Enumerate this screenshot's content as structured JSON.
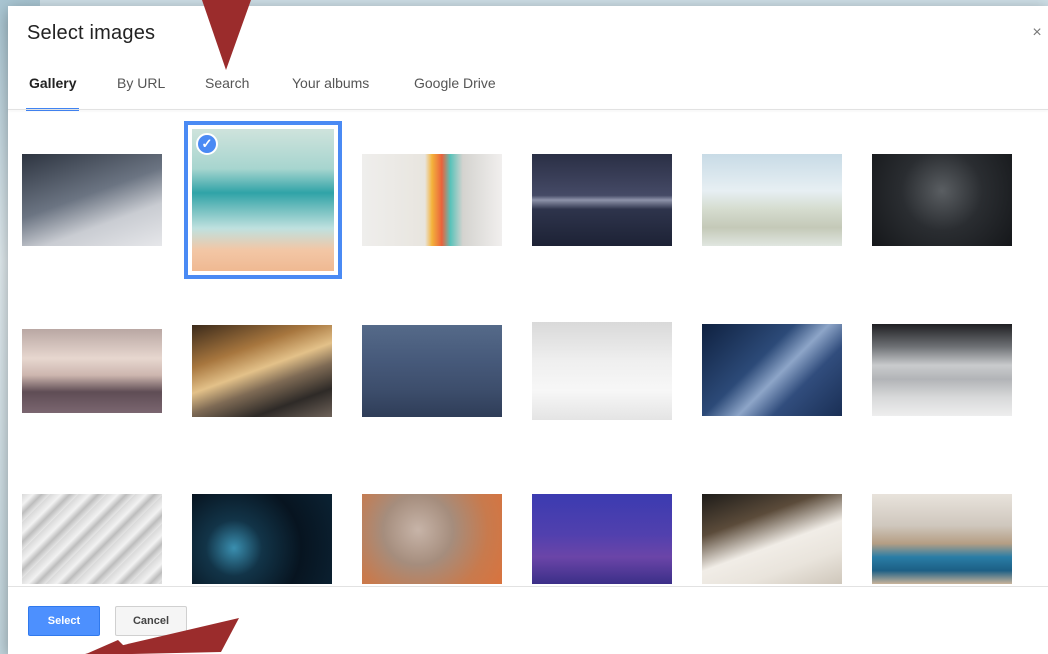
{
  "dialog": {
    "title": "Select images",
    "close_glyph": "×",
    "tabs": [
      {
        "label": "Gallery",
        "active": true
      },
      {
        "label": "By URL",
        "active": false
      },
      {
        "label": "Search",
        "active": false
      },
      {
        "label": "Your albums",
        "active": false
      },
      {
        "label": "Google Drive",
        "active": false
      }
    ],
    "selected_index": 1,
    "check_glyph": "✓",
    "buttons": {
      "select_label": "Select",
      "cancel_label": "Cancel"
    }
  },
  "colors": {
    "accent": "#4285f4",
    "annotation_arrow": "#9b2c2c"
  }
}
